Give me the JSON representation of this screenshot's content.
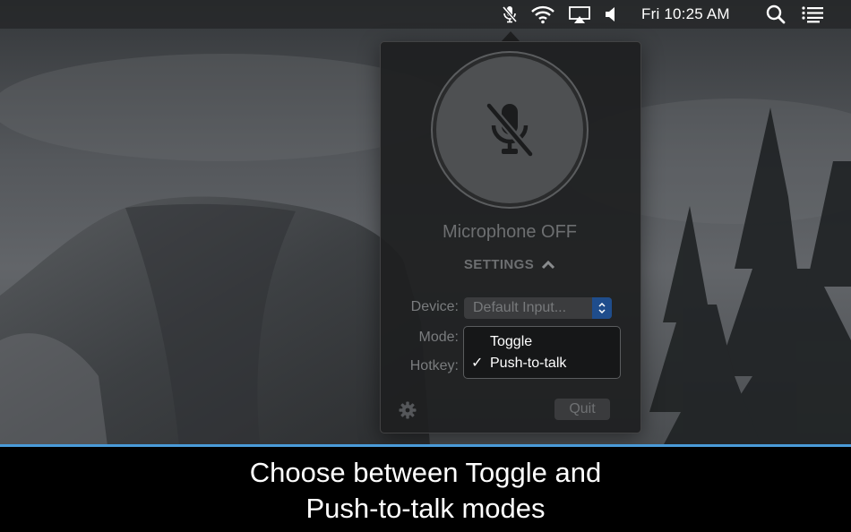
{
  "menubar": {
    "clock": "Fri 10:25 AM",
    "icons": [
      "mic-muted-icon",
      "wifi-icon",
      "airplay-icon",
      "volume-icon",
      "search-icon",
      "notification-center-icon"
    ]
  },
  "popover": {
    "status": "Microphone OFF",
    "settings_label": "SETTINGS",
    "device": {
      "label": "Device:",
      "value": "Default Input..."
    },
    "mode": {
      "label": "Mode:",
      "options": [
        {
          "label": "Toggle",
          "checked": false
        },
        {
          "label": "Push-to-talk",
          "checked": true
        }
      ],
      "check_glyph": "✓"
    },
    "hotkey": {
      "label": "Hotkey:"
    },
    "quit_label": "Quit"
  },
  "caption": {
    "line1": "Choose between Toggle and",
    "line2": "Push-to-talk modes"
  },
  "colors": {
    "accent_blue": "#4a9bd9",
    "stepper_blue": "#1f4d8c",
    "popover_bg": "#1e1f20"
  }
}
